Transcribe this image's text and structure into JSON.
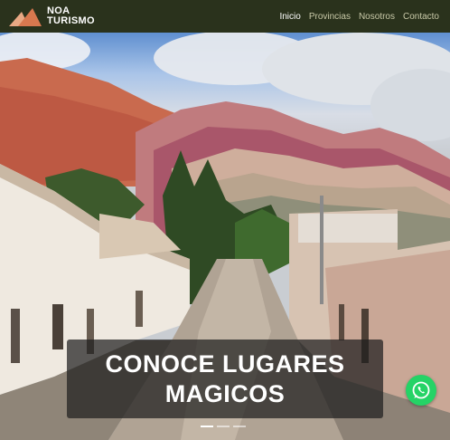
{
  "brand": {
    "line1": "NOA",
    "line2": "TURISMO",
    "logo_colors": [
      "#e8a884",
      "#d8784f"
    ]
  },
  "nav": {
    "items": [
      {
        "label": "Inicio",
        "active": true
      },
      {
        "label": "Provincias",
        "active": false
      },
      {
        "label": "Nosotros",
        "active": false
      },
      {
        "label": "Contacto",
        "active": false
      }
    ]
  },
  "hero": {
    "caption": "CONOCE LUGARES MAGICOS",
    "slide_count": 3,
    "active_slide": 1
  },
  "whatsapp": {
    "icon": "whatsapp-icon",
    "color": "#25d366"
  },
  "colors": {
    "navbar": "#2a321c",
    "nav_text": "#c9c9a8",
    "nav_active": "#ffffff"
  }
}
